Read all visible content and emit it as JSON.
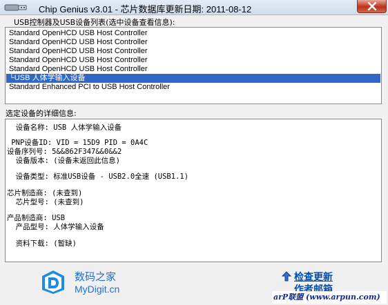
{
  "window": {
    "title": "Chip Genius v3.01 - 芯片数据库更新日期: 2011-08-12",
    "close_icon": "close-icon"
  },
  "device_list": {
    "label": "USB控制器及USB设备列表(选中设备查看信息):",
    "items": [
      "Standard OpenHCD USB Host Controller",
      "Standard OpenHCD USB Host Controller",
      "Standard OpenHCD USB Host Controller",
      "Standard OpenHCD USB Host Controller",
      "Standard OpenHCD USB Host Controller",
      "└USB 人体学输入设备",
      "Standard Enhanced PCI to USB Host Controller"
    ],
    "selected_index": 5
  },
  "details": {
    "label": "选定设备的详细信息:",
    "lines": [
      "  设备名称: USB 人体学输入设备",
      "",
      " PNP设备ID: VID = 15D9 PID = 0A4C",
      "设备序列号: 5&&862F347&&0&&2",
      "  设备版本: (设备未返回此信息)",
      "",
      "  设备类型: 标准USB设备 - USB2.0全速 (USB1.1)",
      "",
      "芯片制造商: (未查到)",
      "  芯片型号: (未查到)",
      "",
      "产品制造商: USB",
      "  产品型号: 人体学输入设备",
      "",
      "  资料下载: (暂缺)"
    ]
  },
  "footer": {
    "brand_name": "数码之家",
    "brand_url": "MyDigit.cn",
    "check_update": "检查更新",
    "contact_author": "作者邮箱",
    "watermark": "arP联盟 (www.arpun.com)"
  },
  "colors": {
    "selection": "#3168c6",
    "link": "#0050b0",
    "brand": "#1d6fd1",
    "close_button": "#c74532"
  }
}
